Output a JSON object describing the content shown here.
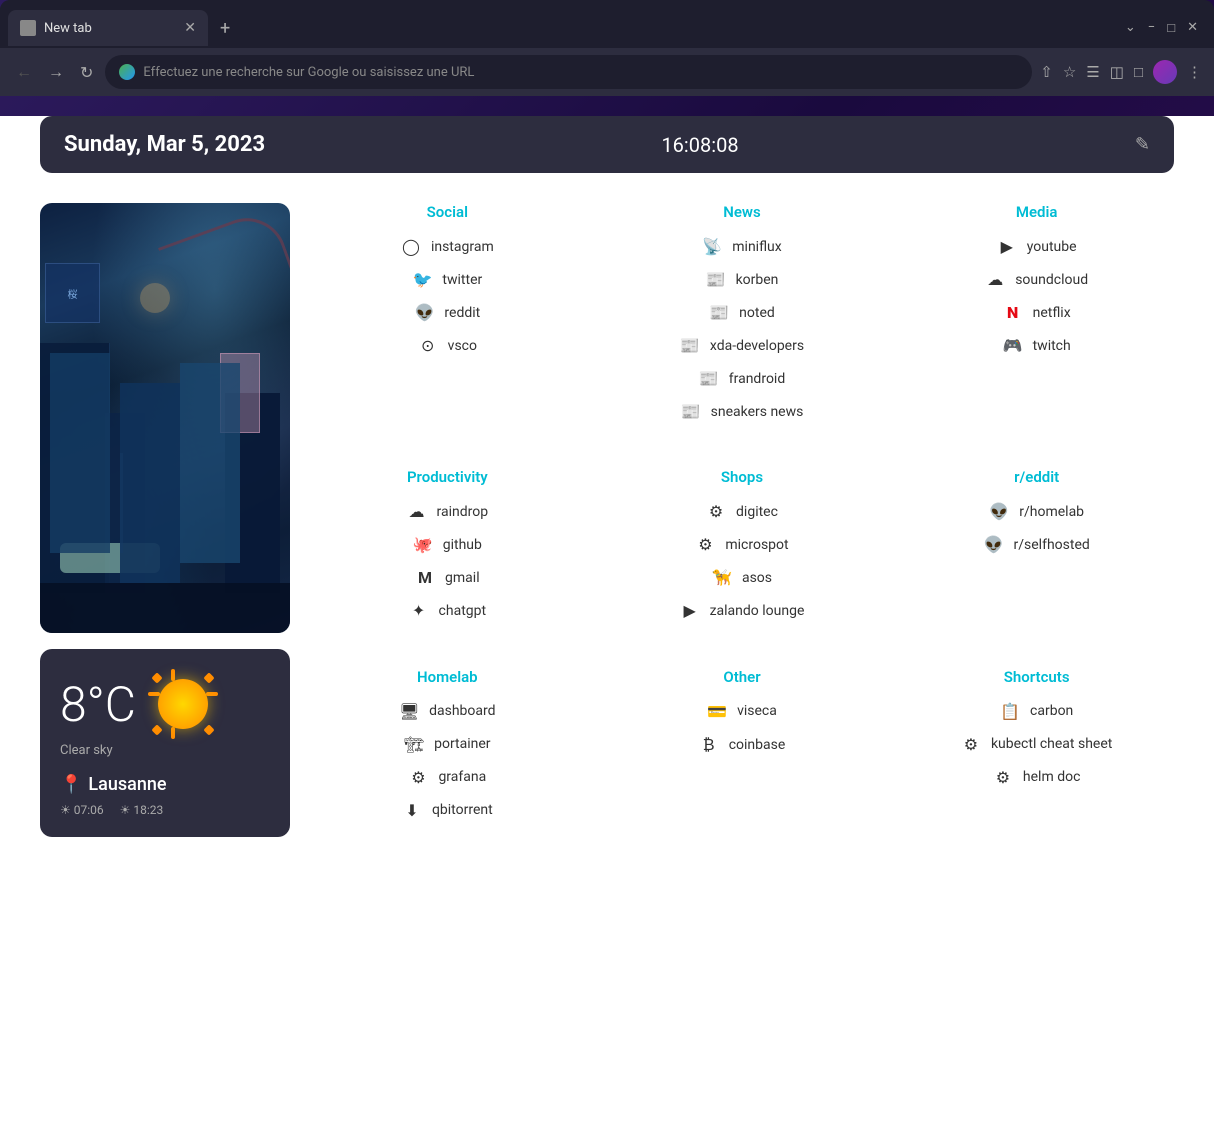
{
  "browser": {
    "tab_label": "New tab",
    "new_tab_symbol": "+",
    "minimize": "−",
    "maximize": "□",
    "close": "✕",
    "collapse": "⌄",
    "address_placeholder": "Effectuez une recherche sur Google ou saisissez une URL"
  },
  "datetime": {
    "date": "Sunday, Mar 5, 2023",
    "time": "16:08:08"
  },
  "weather": {
    "temperature": "8°C",
    "description": "Clear sky",
    "city": "Lausanne",
    "sunrise": "☀ 07:06",
    "sunset": "☀ 18:23"
  },
  "categories": {
    "social": {
      "title": "Social",
      "links": [
        {
          "label": "instagram",
          "icon": "📷"
        },
        {
          "label": "twitter",
          "icon": "🐦"
        },
        {
          "label": "reddit",
          "icon": "🔴"
        },
        {
          "label": "vsco",
          "icon": "⭕"
        }
      ]
    },
    "news": {
      "title": "News",
      "links": [
        {
          "label": "miniflux",
          "icon": "📡"
        },
        {
          "label": "korben",
          "icon": "📰"
        },
        {
          "label": "noted",
          "icon": "📰"
        },
        {
          "label": "xda-developers",
          "icon": "📰"
        },
        {
          "label": "frandroid",
          "icon": "📰"
        },
        {
          "label": "sneakers news",
          "icon": "📰"
        }
      ]
    },
    "media": {
      "title": "Media",
      "links": [
        {
          "label": "youtube",
          "icon": "▶"
        },
        {
          "label": "soundcloud",
          "icon": "☁"
        },
        {
          "label": "netflix",
          "icon": "N"
        },
        {
          "label": "twitch",
          "icon": "🎮"
        }
      ]
    },
    "productivity": {
      "title": "Productivity",
      "links": [
        {
          "label": "raindrop",
          "icon": "☁"
        },
        {
          "label": "github",
          "icon": "🐙"
        },
        {
          "label": "gmail",
          "icon": "M"
        },
        {
          "label": "chatgpt",
          "icon": "✦"
        }
      ]
    },
    "shops": {
      "title": "Shops",
      "links": [
        {
          "label": "digitec",
          "icon": "⚙"
        },
        {
          "label": "microspot",
          "icon": "⚙"
        },
        {
          "label": "asos",
          "icon": "🦮"
        },
        {
          "label": "zalando lounge",
          "icon": "▶"
        }
      ]
    },
    "reddit": {
      "title": "r/eddit",
      "links": [
        {
          "label": "r/homelab",
          "icon": "🔴"
        },
        {
          "label": "r/selfhosted",
          "icon": "🔴"
        }
      ]
    },
    "homelab": {
      "title": "Homelab",
      "links": [
        {
          "label": "dashboard",
          "icon": "🖥"
        },
        {
          "label": "portainer",
          "icon": "🏗"
        },
        {
          "label": "grafana",
          "icon": "⚙"
        },
        {
          "label": "qbitorrent",
          "icon": "⬇"
        }
      ]
    },
    "other": {
      "title": "Other",
      "links": [
        {
          "label": "viseca",
          "icon": "💳"
        },
        {
          "label": "coinbase",
          "icon": "₿"
        }
      ]
    },
    "shortcuts": {
      "title": "Shortcuts",
      "links": [
        {
          "label": "carbon",
          "icon": "📋"
        },
        {
          "label": "kubectl cheat sheet",
          "icon": "⚙"
        },
        {
          "label": "helm doc",
          "icon": "⚙"
        }
      ]
    }
  }
}
